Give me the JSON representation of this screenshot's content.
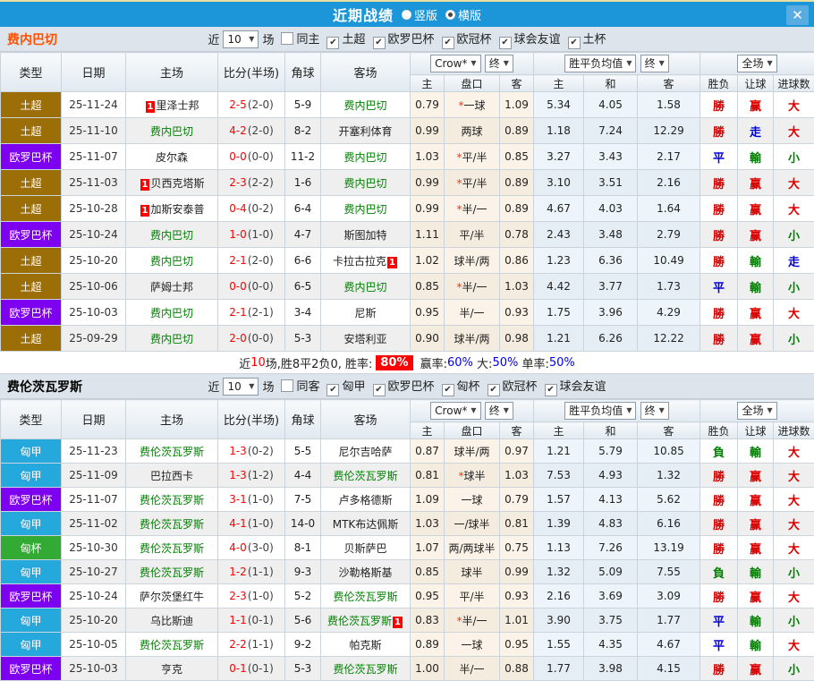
{
  "header": {
    "title": "近期战绩",
    "vertical_label": "竖版",
    "horizontal_label": "横版",
    "close_glyph": "✕"
  },
  "labels": {
    "near": "近",
    "games": "场"
  },
  "columns": {
    "type": "类型",
    "date": "日期",
    "home": "主场",
    "score": "比分(半场)",
    "corner": "角球",
    "away": "客场",
    "crow": "Crow*",
    "final": "终",
    "avg": "胜平负均值",
    "full": "全场",
    "sub": [
      "主",
      "盘口",
      "客",
      "主",
      "和",
      "客",
      "胜负",
      "让球",
      "进球数"
    ]
  },
  "league_colors": {
    "土超": "#9c6e08",
    "欧罗巴杯": "#7d00f0",
    "匈甲": "#25a8db",
    "匈杯": "#33aa33"
  },
  "result_colors": {
    "勝": "#d80000",
    "負": "#008000",
    "平": "#0000d8",
    "赢": "#d80000",
    "輸": "#008000",
    "走": "#0000d8",
    "大": "#d80000",
    "小": "#008000"
  },
  "sections": [
    {
      "title": "费内巴切",
      "title_color": "#ff5000",
      "near_count": "10",
      "filters": [
        {
          "label": "同主",
          "checked": false
        },
        {
          "label": "土超",
          "checked": true
        },
        {
          "label": "欧罗巴杯",
          "checked": true
        },
        {
          "label": "欧冠杯",
          "checked": true
        },
        {
          "label": "球会友谊",
          "checked": true
        },
        {
          "label": "土杯",
          "checked": true
        }
      ],
      "rows": [
        {
          "lg": "土超",
          "dt": "25-11-24",
          "hb": "1",
          "hm": "里泽士邦",
          "hg": false,
          "sc": "2-5",
          "hf": "(2-0)",
          "cn": "5-9",
          "ab": "",
          "aw": "费内巴切",
          "ag": true,
          "oh": "0.79",
          "hc": "*一球",
          "oa": "1.09",
          "mh": "5.34",
          "md": "4.05",
          "ma": "1.58",
          "r1": "勝",
          "r2": "赢",
          "r3": "大"
        },
        {
          "lg": "土超",
          "dt": "25-11-10",
          "hb": "",
          "hm": "费内巴切",
          "hg": true,
          "sc": "4-2",
          "hf": "(2-0)",
          "cn": "8-2",
          "ab": "",
          "aw": "开塞利体育",
          "ag": false,
          "oh": "0.99",
          "hc": "两球",
          "oa": "0.89",
          "mh": "1.18",
          "md": "7.24",
          "ma": "12.29",
          "r1": "勝",
          "r2": "走",
          "r3": "大"
        },
        {
          "lg": "欧罗巴杯",
          "dt": "25-11-07",
          "hb": "",
          "hm": "皮尔森",
          "hg": false,
          "sc": "0-0",
          "hf": "(0-0)",
          "cn": "11-2",
          "ab": "",
          "aw": "费内巴切",
          "ag": true,
          "oh": "1.03",
          "hc": "*平/半",
          "oa": "0.85",
          "mh": "3.27",
          "md": "3.43",
          "ma": "2.17",
          "r1": "平",
          "r2": "輸",
          "r3": "小"
        },
        {
          "lg": "土超",
          "dt": "25-11-03",
          "hb": "1",
          "hm": "贝西克塔斯",
          "hg": false,
          "sc": "2-3",
          "hf": "(2-2)",
          "cn": "1-6",
          "ab": "",
          "aw": "费内巴切",
          "ag": true,
          "oh": "0.99",
          "hc": "*平/半",
          "oa": "0.89",
          "mh": "3.10",
          "md": "3.51",
          "ma": "2.16",
          "r1": "勝",
          "r2": "赢",
          "r3": "大"
        },
        {
          "lg": "土超",
          "dt": "25-10-28",
          "hb": "1",
          "hm": "加斯安泰普",
          "hg": false,
          "sc": "0-4",
          "hf": "(0-2)",
          "cn": "6-4",
          "ab": "",
          "aw": "费内巴切",
          "ag": true,
          "oh": "0.99",
          "hc": "*半/一",
          "oa": "0.89",
          "mh": "4.67",
          "md": "4.03",
          "ma": "1.64",
          "r1": "勝",
          "r2": "赢",
          "r3": "大"
        },
        {
          "lg": "欧罗巴杯",
          "dt": "25-10-24",
          "hb": "",
          "hm": "费内巴切",
          "hg": true,
          "sc": "1-0",
          "hf": "(1-0)",
          "cn": "4-7",
          "ab": "",
          "aw": "斯图加特",
          "ag": false,
          "oh": "1.11",
          "hc": "平/半",
          "oa": "0.78",
          "mh": "2.43",
          "md": "3.48",
          "ma": "2.79",
          "r1": "勝",
          "r2": "赢",
          "r3": "小"
        },
        {
          "lg": "土超",
          "dt": "25-10-20",
          "hb": "",
          "hm": "费内巴切",
          "hg": true,
          "sc": "2-1",
          "hf": "(2-0)",
          "cn": "6-6",
          "ab": "1",
          "aw": "卡拉古拉克",
          "ag": false,
          "oh": "1.02",
          "hc": "球半/两",
          "oa": "0.86",
          "mh": "1.23",
          "md": "6.36",
          "ma": "10.49",
          "r1": "勝",
          "r2": "輸",
          "r3": "走"
        },
        {
          "lg": "土超",
          "dt": "25-10-06",
          "hb": "",
          "hm": "萨姆士邦",
          "hg": false,
          "sc": "0-0",
          "hf": "(0-0)",
          "cn": "6-5",
          "ab": "",
          "aw": "费内巴切",
          "ag": true,
          "oh": "0.85",
          "hc": "*半/一",
          "oa": "1.03",
          "mh": "4.42",
          "md": "3.77",
          "ma": "1.73",
          "r1": "平",
          "r2": "輸",
          "r3": "小"
        },
        {
          "lg": "欧罗巴杯",
          "dt": "25-10-03",
          "hb": "",
          "hm": "费内巴切",
          "hg": true,
          "sc": "2-1",
          "hf": "(2-1)",
          "cn": "3-4",
          "ab": "",
          "aw": "尼斯",
          "ag": false,
          "oh": "0.95",
          "hc": "半/一",
          "oa": "0.93",
          "mh": "1.75",
          "md": "3.96",
          "ma": "4.29",
          "r1": "勝",
          "r2": "赢",
          "r3": "大"
        },
        {
          "lg": "土超",
          "dt": "25-09-29",
          "hb": "",
          "hm": "费内巴切",
          "hg": true,
          "sc": "2-0",
          "hf": "(0-0)",
          "cn": "5-3",
          "ab": "",
          "aw": "安塔利亚",
          "ag": false,
          "oh": "0.90",
          "hc": "球半/两",
          "oa": "0.98",
          "mh": "1.21",
          "md": "6.26",
          "ma": "12.22",
          "r1": "勝",
          "r2": "赢",
          "r3": "小"
        }
      ],
      "summary": [
        {
          "t": "近",
          "n": "summary-text"
        },
        {
          "t": "10",
          "c": "red",
          "n": "summary-count"
        },
        {
          "t": "场,胜8平2负0, 胜率:",
          "n": "summary-text"
        },
        {
          "t": "80%",
          "c": "badge",
          "n": "win-rate-badge"
        },
        {
          "t": " 赢率:",
          "n": "summary-text"
        },
        {
          "t": "60%",
          "c": "blue",
          "n": "handicap-win-rate"
        },
        {
          "t": " 大:",
          "n": "summary-text"
        },
        {
          "t": "50%",
          "c": "blue",
          "n": "over-rate"
        },
        {
          "t": " 单率:",
          "n": "summary-text"
        },
        {
          "t": "50%",
          "c": "blue",
          "n": "odd-rate"
        }
      ]
    },
    {
      "title": "费伦茨瓦罗斯",
      "title_color": "#000000",
      "near_count": "10",
      "filters": [
        {
          "label": "同客",
          "checked": false
        },
        {
          "label": "匈甲",
          "checked": true
        },
        {
          "label": "欧罗巴杯",
          "checked": true
        },
        {
          "label": "匈杯",
          "checked": true
        },
        {
          "label": "欧冠杯",
          "checked": true
        },
        {
          "label": "球会友谊",
          "checked": true
        }
      ],
      "rows": [
        {
          "lg": "匈甲",
          "dt": "25-11-23",
          "hb": "",
          "hm": "费伦茨瓦罗斯",
          "hg": true,
          "sc": "1-3",
          "hf": "(0-2)",
          "cn": "5-5",
          "ab": "",
          "aw": "尼尔吉哈萨",
          "ag": false,
          "oh": "0.87",
          "hc": "球半/两",
          "oa": "0.97",
          "mh": "1.21",
          "md": "5.79",
          "ma": "10.85",
          "r1": "負",
          "r2": "輸",
          "r3": "大"
        },
        {
          "lg": "匈甲",
          "dt": "25-11-09",
          "hb": "",
          "hm": "巴拉西卡",
          "hg": false,
          "sc": "1-3",
          "hf": "(1-2)",
          "cn": "4-4",
          "ab": "",
          "aw": "费伦茨瓦罗斯",
          "ag": true,
          "oh": "0.81",
          "hc": "*球半",
          "oa": "1.03",
          "mh": "7.53",
          "md": "4.93",
          "ma": "1.32",
          "r1": "勝",
          "r2": "赢",
          "r3": "大"
        },
        {
          "lg": "欧罗巴杯",
          "dt": "25-11-07",
          "hb": "",
          "hm": "费伦茨瓦罗斯",
          "hg": true,
          "sc": "3-1",
          "hf": "(1-0)",
          "cn": "7-5",
          "ab": "",
          "aw": "卢多格德斯",
          "ag": false,
          "oh": "1.09",
          "hc": "一球",
          "oa": "0.79",
          "mh": "1.57",
          "md": "4.13",
          "ma": "5.62",
          "r1": "勝",
          "r2": "赢",
          "r3": "大"
        },
        {
          "lg": "匈甲",
          "dt": "25-11-02",
          "hb": "",
          "hm": "费伦茨瓦罗斯",
          "hg": true,
          "sc": "4-1",
          "hf": "(1-0)",
          "cn": "14-0",
          "ab": "",
          "aw": "MTK布达佩斯",
          "ag": false,
          "oh": "1.03",
          "hc": "一/球半",
          "oa": "0.81",
          "mh": "1.39",
          "md": "4.83",
          "ma": "6.16",
          "r1": "勝",
          "r2": "赢",
          "r3": "大"
        },
        {
          "lg": "匈杯",
          "dt": "25-10-30",
          "hb": "",
          "hm": "费伦茨瓦罗斯",
          "hg": true,
          "sc": "4-0",
          "hf": "(3-0)",
          "cn": "8-1",
          "ab": "",
          "aw": "贝斯萨巴",
          "ag": false,
          "oh": "1.07",
          "hc": "两/两球半",
          "oa": "0.75",
          "mh": "1.13",
          "md": "7.26",
          "ma": "13.19",
          "r1": "勝",
          "r2": "赢",
          "r3": "大"
        },
        {
          "lg": "匈甲",
          "dt": "25-10-27",
          "hb": "",
          "hm": "费伦茨瓦罗斯",
          "hg": true,
          "sc": "1-2",
          "hf": "(1-1)",
          "cn": "9-3",
          "ab": "",
          "aw": "沙勒格斯基",
          "ag": false,
          "oh": "0.85",
          "hc": "球半",
          "oa": "0.99",
          "mh": "1.32",
          "md": "5.09",
          "ma": "7.55",
          "r1": "負",
          "r2": "輸",
          "r3": "小"
        },
        {
          "lg": "欧罗巴杯",
          "dt": "25-10-24",
          "hb": "",
          "hm": "萨尔茨堡红牛",
          "hg": false,
          "sc": "2-3",
          "hf": "(1-0)",
          "cn": "5-2",
          "ab": "",
          "aw": "费伦茨瓦罗斯",
          "ag": true,
          "oh": "0.95",
          "hc": "平/半",
          "oa": "0.93",
          "mh": "2.16",
          "md": "3.69",
          "ma": "3.09",
          "r1": "勝",
          "r2": "赢",
          "r3": "大"
        },
        {
          "lg": "匈甲",
          "dt": "25-10-20",
          "hb": "",
          "hm": "乌比斯迪",
          "hg": false,
          "sc": "1-1",
          "hf": "(0-1)",
          "cn": "5-6",
          "ab": "1",
          "aw": "费伦茨瓦罗斯",
          "ag": true,
          "oh": "0.83",
          "hc": "*半/一",
          "oa": "1.01",
          "mh": "3.90",
          "md": "3.75",
          "ma": "1.77",
          "r1": "平",
          "r2": "輸",
          "r3": "小"
        },
        {
          "lg": "匈甲",
          "dt": "25-10-05",
          "hb": "",
          "hm": "费伦茨瓦罗斯",
          "hg": true,
          "sc": "2-2",
          "hf": "(1-1)",
          "cn": "9-2",
          "ab": "",
          "aw": "帕克斯",
          "ag": false,
          "oh": "0.89",
          "hc": "一球",
          "oa": "0.95",
          "mh": "1.55",
          "md": "4.35",
          "ma": "4.67",
          "r1": "平",
          "r2": "輸",
          "r3": "大"
        },
        {
          "lg": "欧罗巴杯",
          "dt": "25-10-03",
          "hb": "",
          "hm": "亨克",
          "hg": false,
          "sc": "0-1",
          "hf": "(0-1)",
          "cn": "5-3",
          "ab": "",
          "aw": "费伦茨瓦罗斯",
          "ag": true,
          "oh": "1.00",
          "hc": "半/一",
          "oa": "0.88",
          "mh": "1.77",
          "md": "3.98",
          "ma": "4.15",
          "r1": "勝",
          "r2": "赢",
          "r3": "小"
        }
      ]
    }
  ]
}
